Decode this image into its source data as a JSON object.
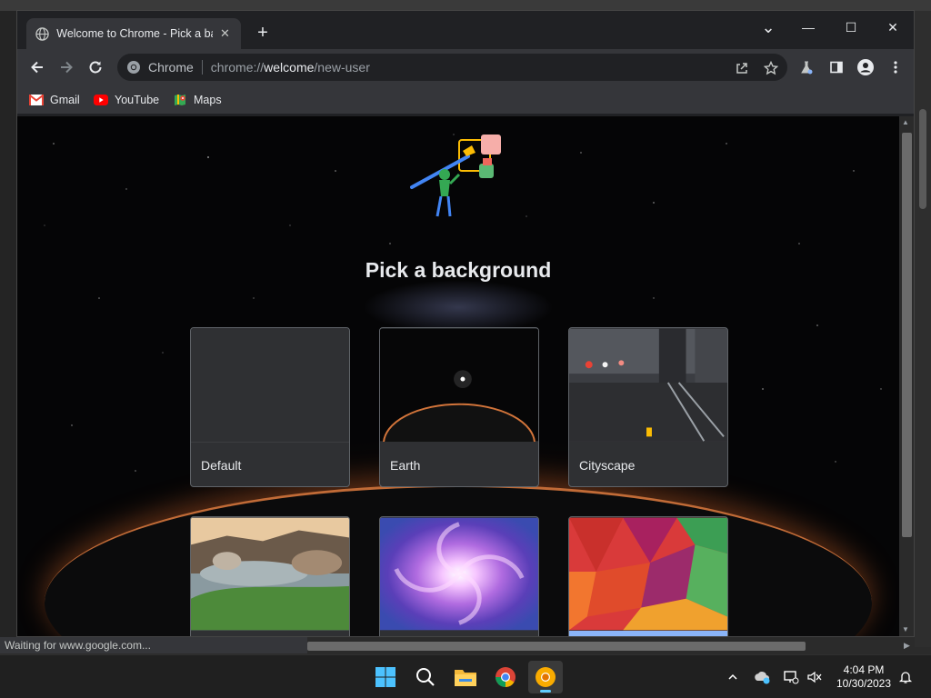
{
  "window": {
    "tab_title": "Welcome to Chrome - Pick a background",
    "tab_close": "✕",
    "new_tab": "+",
    "minimize": "—",
    "maximize": "☐",
    "close": "✕",
    "dropdown": "⌄"
  },
  "omnibox": {
    "chip": "Chrome",
    "url_prefix": "chrome://",
    "url_host": "welcome",
    "url_path": "/new-user"
  },
  "bookmarks": [
    {
      "label": "Gmail"
    },
    {
      "label": "YouTube"
    },
    {
      "label": "Maps"
    }
  ],
  "page": {
    "heading": "Pick a background",
    "cards": [
      {
        "label": "Default"
      },
      {
        "label": "Earth"
      },
      {
        "label": "Cityscape"
      },
      {
        "label": ""
      },
      {
        "label": ""
      },
      {
        "label": ""
      }
    ]
  },
  "status": {
    "text": "Waiting for www.google.com..."
  },
  "taskbar": {
    "time": "4:04 PM",
    "date": "10/30/2023"
  },
  "colors": {
    "accent": "#60cdff",
    "chrome_dark": "#202124",
    "toolbar": "#35363a"
  }
}
